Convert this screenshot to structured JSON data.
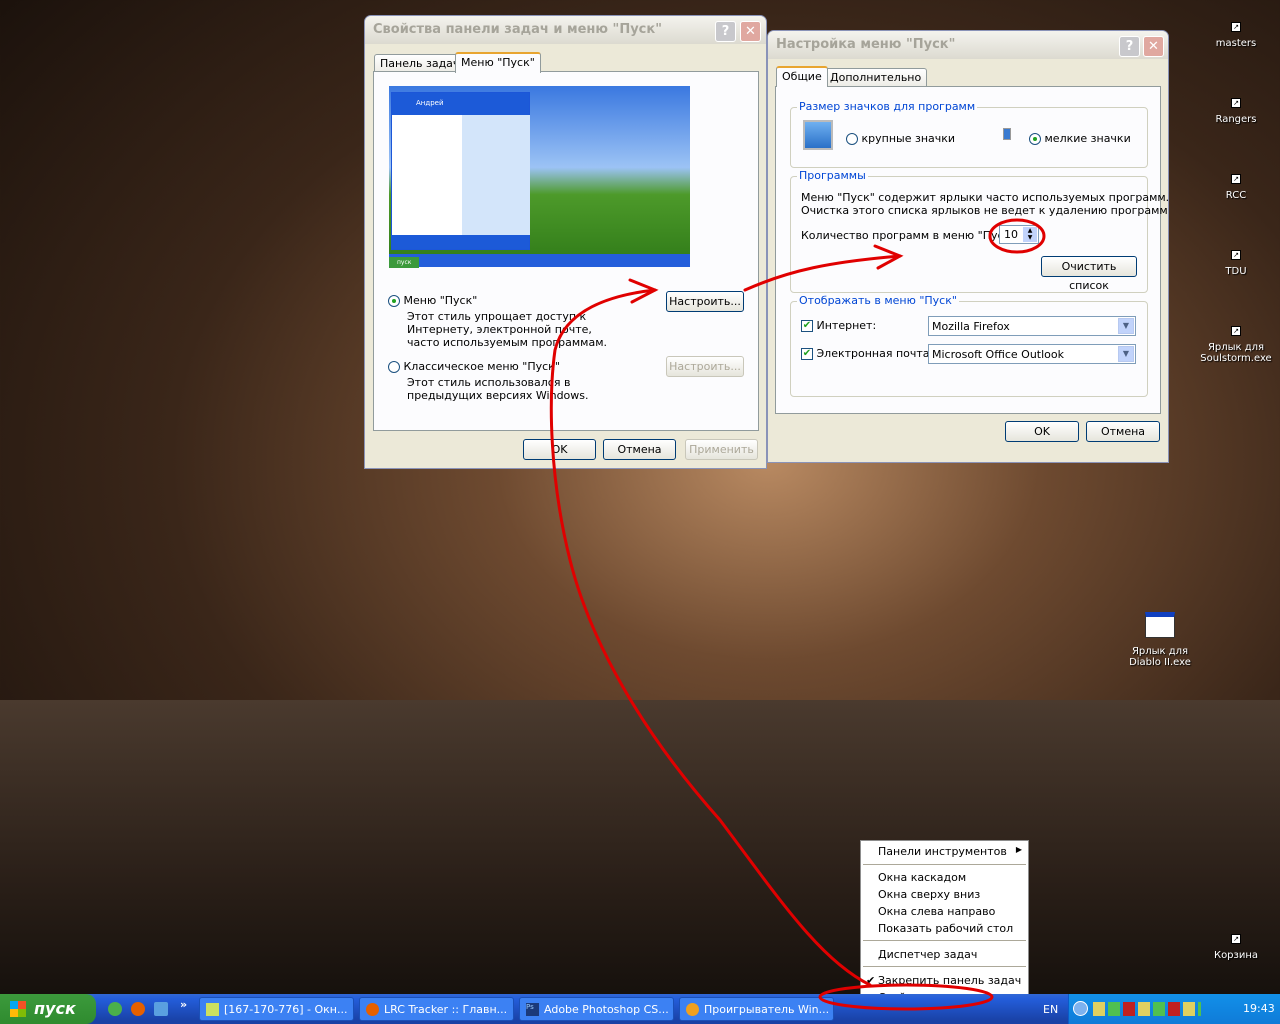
{
  "desktop_icons": [
    {
      "label": "masters"
    },
    {
      "label": "Rangers"
    },
    {
      "label": "RCC"
    },
    {
      "label": "TDU"
    },
    {
      "label": "Ярлык для Soulstorm.exe"
    },
    {
      "label": "Ярлык для Diablo II.exe"
    },
    {
      "label": "Корзина"
    }
  ],
  "taskbar_props": {
    "title": "Свойства панели задач и меню \"Пуск\"",
    "tabs": [
      "Панель задач",
      "Меню \"Пуск\""
    ],
    "preview_user": "Андрей",
    "preview_start": "пуск",
    "start_menu_option": {
      "label": "Меню \"Пуск\"",
      "description": "Этот стиль упрощает доступ к Интернету, электронной почте, часто используемым программам.",
      "customize": "Настроить...",
      "selected": true
    },
    "classic_option": {
      "label": "Классическое меню \"Пуск\"",
      "description": "Этот стиль использовался в предыдущих версиях Windows.",
      "customize": "Настроить...",
      "selected": false
    },
    "ok": "OK",
    "cancel": "Отмена",
    "apply": "Применить"
  },
  "customize": {
    "title": "Настройка меню \"Пуск\"",
    "tabs": [
      "Общие",
      "Дополнительно"
    ],
    "icon_size_group": "Размер значков для программ",
    "large_icons": "крупные значки",
    "small_icons": "мелкие значки",
    "selected_size": "small",
    "programs_group": "Программы",
    "programs_text1": "Меню \"Пуск\" содержит ярлыки часто используемых программ.",
    "programs_text2": "Очистка этого списка ярлыков не ведет к удалению программ.",
    "count_label": "Количество программ в меню \"Пуск\":",
    "count_value": "10",
    "clear_list": "Очистить список",
    "show_group": "Отображать в меню \"Пуск\"",
    "internet_label": "Интернет:",
    "internet_value": "Mozilla Firefox",
    "internet_checked": true,
    "email_label": "Электронная почта:",
    "email_value": "Microsoft Office Outlook",
    "email_checked": true,
    "ok": "OK",
    "cancel": "Отмена"
  },
  "context_menu": {
    "toolbars": "Панели инструментов",
    "cascade": "Окна каскадом",
    "tile_h": "Окна сверху вниз",
    "tile_v": "Окна слева направо",
    "show_desktop": "Показать рабочий стол",
    "task_manager": "Диспетчер задач",
    "lock_taskbar": "Закрепить панель задач",
    "lock_checked": true,
    "properties": "Свойства"
  },
  "taskbar": {
    "start": "пуск",
    "tasks": [
      "[167-170-776] - Окн...",
      "LRC Tracker :: Главн...",
      "Adobe Photoshop CS...",
      "Проигрыватель Win..."
    ],
    "lang": "EN",
    "clock": "19:43"
  },
  "colors": {
    "annotation": "#e00000",
    "title_active": "#0a246a"
  }
}
